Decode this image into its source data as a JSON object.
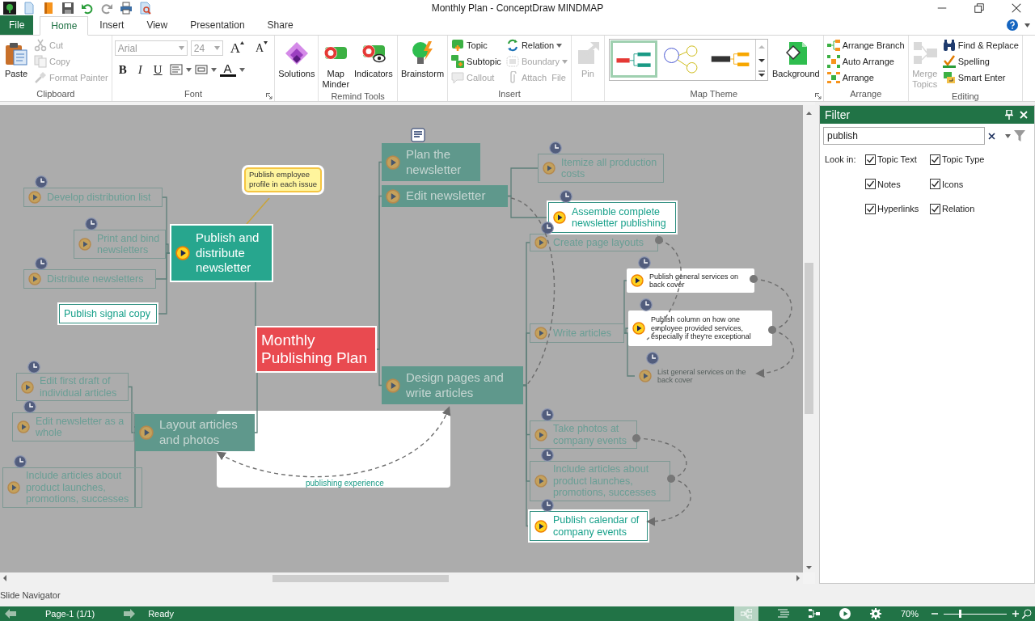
{
  "window": {
    "title": "Monthly Plan - ConceptDraw MINDMAP"
  },
  "tabs": [
    {
      "label": "File",
      "kind": "file",
      "selected": false
    },
    {
      "label": "Home",
      "kind": "tab",
      "selected": true
    },
    {
      "label": "Insert",
      "kind": "tab",
      "selected": false
    },
    {
      "label": "View",
      "kind": "tab",
      "selected": false
    },
    {
      "label": "Presentation",
      "kind": "tab",
      "selected": false
    },
    {
      "label": "Share",
      "kind": "tab",
      "selected": false
    }
  ],
  "ribbon": [
    {
      "label": "Clipboard",
      "kind": "buttons",
      "buttons": [
        {
          "label": "Paste",
          "kind": "large",
          "disabled": false
        },
        {
          "label": "Cut",
          "kind": "small",
          "disabled": true,
          "dropdown": false
        },
        {
          "label": "Copy",
          "kind": "small",
          "disabled": true,
          "dropdown": false
        },
        {
          "label": "Format Painter",
          "kind": "small",
          "disabled": true,
          "dropdown": false
        }
      ]
    },
    {
      "label": "Font",
      "kind": "font",
      "launcher": true,
      "font": "Arial",
      "size": "24",
      "size_buttons": [
        "A",
        "A"
      ],
      "format_buttons": [
        "B",
        "I",
        "U"
      ],
      "color_button": "A"
    },
    {
      "kind": "buttons",
      "buttons": [
        {
          "label": "Solutions",
          "kind": "large",
          "disabled": false
        }
      ]
    },
    {
      "label": "Remind Tools",
      "kind": "buttons",
      "buttons": [
        {
          "label": "Map\nMinder",
          "kind": "large",
          "disabled": false
        },
        {
          "label": "Indicators",
          "kind": "large",
          "disabled": false
        }
      ]
    },
    {
      "kind": "buttons",
      "buttons": [
        {
          "label": "Brainstorm",
          "kind": "large",
          "disabled": false
        }
      ]
    },
    {
      "label": "Insert",
      "kind": "buttons",
      "buttons": [
        {
          "label": "Topic",
          "kind": "small",
          "disabled": false,
          "dropdown": false
        },
        {
          "label": "Subtopic",
          "kind": "small",
          "disabled": false,
          "dropdown": false
        },
        {
          "label": "Callout",
          "kind": "small",
          "disabled": true,
          "dropdown": false
        },
        {
          "label": "Relation",
          "kind": "small",
          "disabled": false,
          "dropdown": true
        },
        {
          "label": "Boundary",
          "kind": "small",
          "disabled": true,
          "dropdown": true
        },
        {
          "label": "Attach  File",
          "kind": "small",
          "disabled": true,
          "dropdown": false
        }
      ]
    },
    {
      "kind": "buttons",
      "buttons": [
        {
          "label": "Pin",
          "kind": "large",
          "disabled": true
        }
      ]
    },
    {
      "label": "Map Theme",
      "kind": "theme",
      "launcher": true,
      "themes": [
        {
          "selected": true
        },
        {
          "selected": false
        },
        {
          "selected": false
        }
      ],
      "buttons": [
        {
          "label": "Background",
          "kind": "large",
          "disabled": false
        }
      ]
    },
    {
      "label": "Arrange",
      "kind": "buttons",
      "buttons": [
        {
          "label": "Arrange Branch",
          "kind": "small",
          "disabled": false,
          "dropdown": false
        },
        {
          "label": "Auto Arrange",
          "kind": "small",
          "disabled": false,
          "dropdown": false
        },
        {
          "label": "Arrange",
          "kind": "small",
          "disabled": false,
          "dropdown": false
        }
      ]
    },
    {
      "label": "Editing",
      "kind": "buttons",
      "buttons": [
        {
          "label": "Merge\nTopics",
          "kind": "large",
          "disabled": true
        },
        {
          "label": "Find & Replace",
          "kind": "small",
          "disabled": false,
          "dropdown": false
        },
        {
          "label": "Spelling",
          "kind": "small",
          "disabled": false,
          "dropdown": false
        },
        {
          "label": "Smart Enter",
          "kind": "small",
          "disabled": false,
          "dropdown": false
        }
      ]
    }
  ],
  "map": {
    "root": {
      "text": "Monthly\nPublishing Plan",
      "kind": "central",
      "matched": true,
      "task": false,
      "clock": false,
      "children": [
        {
          "text": "Publish and\ndistribute\nnewsletter",
          "kind": "main",
          "matched": true,
          "task": true,
          "clock": false,
          "callout": "Publish employee\nprofile in each issue",
          "children": [
            {
              "text": "Develop distribution list",
              "kind": "sub",
              "matched": false,
              "task": true,
              "clock": true
            },
            {
              "text": "Print and bind\nnewsletters",
              "kind": "sub",
              "matched": false,
              "task": true,
              "clock": true
            },
            {
              "text": "Distribute newsletters",
              "kind": "sub",
              "matched": false,
              "task": true,
              "clock": true
            },
            {
              "text": "Publish signal copy",
              "kind": "sub",
              "matched": true,
              "task": false,
              "clock": false
            }
          ]
        },
        {
          "text": "Layout articles\nand photos",
          "kind": "main",
          "matched": false,
          "task": true,
          "clock": false,
          "children": [
            {
              "text": "Edit first draft of\nindividual articles",
              "kind": "sub",
              "matched": false,
              "task": true,
              "clock": true
            },
            {
              "text": "Edit newsletter as a\nwhole",
              "kind": "sub",
              "matched": false,
              "task": true,
              "clock": true
            },
            {
              "text": "Include articles about\nproduct launches,\npromotions, successes",
              "kind": "sub",
              "matched": false,
              "task": true,
              "clock": true
            }
          ]
        },
        {
          "text": "Plan the\nnewsletter",
          "kind": "main",
          "matched": false,
          "task": true,
          "clock": false,
          "note": true
        },
        {
          "text": "Edit newsletter",
          "kind": "main",
          "matched": false,
          "task": true,
          "clock": false,
          "children": [
            {
              "text": "Itemize all production\ncosts",
              "kind": "sub",
              "matched": false,
              "task": true,
              "clock": true
            },
            {
              "text": "Assemble complete\nnewsletter publishing",
              "kind": "sub",
              "matched": true,
              "task": true,
              "clock": true
            }
          ]
        },
        {
          "text": "Design pages and\nwrite articles",
          "kind": "main",
          "matched": false,
          "task": true,
          "clock": false,
          "children": [
            {
              "text": "Create page layouts",
              "kind": "sub",
              "matched": false,
              "task": true,
              "clock": true
            },
            {
              "text": "Write articles",
              "kind": "sub",
              "matched": false,
              "task": true,
              "clock": false,
              "children": [
                {
                  "text": "Publish general services on\nback cover",
                  "kind": "small",
                  "matched": true,
                  "task": true,
                  "clock": true
                },
                {
                  "text": "Publish column on how one\nemployee provided services,\nespecially if they're exceptional",
                  "kind": "small",
                  "matched": true,
                  "task": true,
                  "clock": true
                },
                {
                  "text": "List general services on the\nback cover",
                  "kind": "small",
                  "matched": false,
                  "task": true,
                  "clock": true
                }
              ]
            },
            {
              "text": "Take photos at\ncompany events",
              "kind": "sub",
              "matched": false,
              "task": true,
              "clock": true
            },
            {
              "text": "Include articles about\nproduct launches,\npromotions, successes",
              "kind": "sub",
              "matched": false,
              "task": true,
              "clock": true
            },
            {
              "text": "Publish calendar of\ncompany events",
              "kind": "sub",
              "matched": true,
              "task": true,
              "clock": true
            }
          ]
        }
      ]
    },
    "relation_label": "publishing experience"
  },
  "filter": {
    "title": "Filter",
    "search": "publish",
    "look_in": "Look in:",
    "options": [
      {
        "label": "Topic Text",
        "checked": true
      },
      {
        "label": "Topic Type",
        "checked": true
      },
      {
        "label": "Notes",
        "checked": true
      },
      {
        "label": "Icons",
        "checked": true
      },
      {
        "label": "Hyperlinks",
        "checked": true
      },
      {
        "label": "Relation",
        "checked": true
      }
    ]
  },
  "slide_navigator": "Slide Navigator",
  "status_bar": {
    "page": "Page-1 (1/1)",
    "state": "Ready",
    "zoom": "70%",
    "zoom_slider": {
      "level": 0.25
    }
  }
}
